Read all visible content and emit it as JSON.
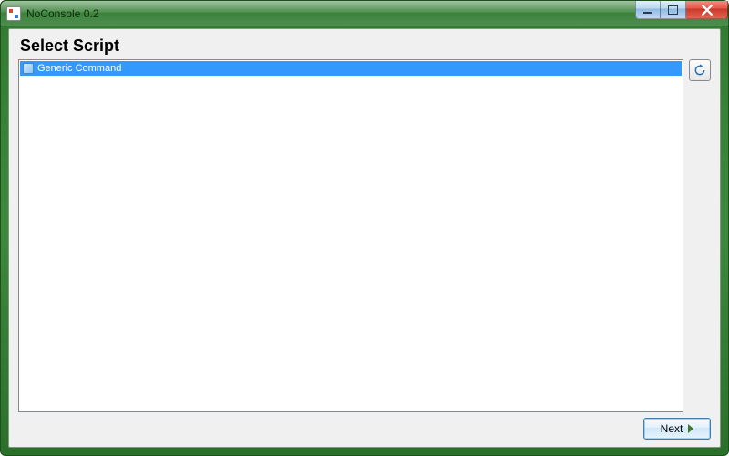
{
  "window": {
    "title": "NoConsole 0.2"
  },
  "page": {
    "heading": "Select Script"
  },
  "scripts": {
    "items": [
      {
        "label": "Generic Command",
        "selected": true
      }
    ]
  },
  "buttons": {
    "next": "Next"
  }
}
